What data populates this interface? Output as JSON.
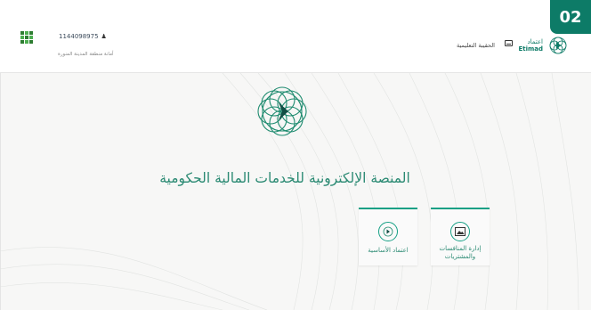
{
  "step_badge": "02",
  "header": {
    "user_id": "1144098975",
    "organization": "أمانة منطقة المدينة المنورة",
    "education_bag_label": "الحقيبة التعليمية",
    "logo_ar": "اعتماد",
    "logo_en": "Etimad"
  },
  "main": {
    "title": "المنصة الإلكترونية للخدمات المالية الحكومية",
    "cards": [
      {
        "label_line1": "إدارة المنافسات",
        "label_line2": "والمشتريات",
        "icon": "image-icon"
      },
      {
        "label_line1": "اعتماد الأساسية",
        "label_line2": "",
        "icon": "etimad-circle-icon"
      }
    ]
  },
  "colors": {
    "accent": "#0d7b67",
    "text_green": "#2b8a73",
    "card_border": "#16a085"
  }
}
